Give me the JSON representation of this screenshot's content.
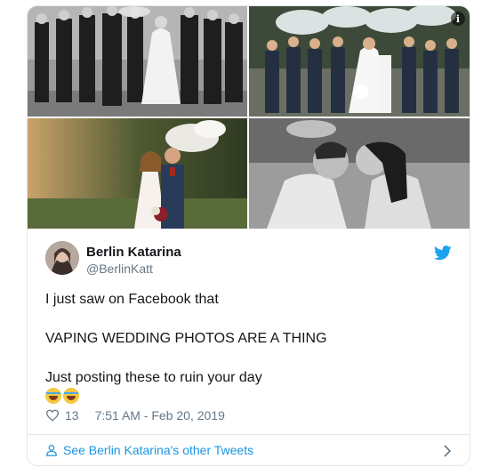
{
  "tweet": {
    "author_name": "Berlin Katarina",
    "author_handle": "@BerlinKatt",
    "text_line1": "I just saw on Facebook that",
    "text_line2": "VAPING WEDDING PHOTOS ARE A THING",
    "text_line3": "Just posting these to ruin your day",
    "emoji": [
      "face-with-tears-of-joy",
      "face-with-tears-of-joy"
    ],
    "likes": "13",
    "timestamp": "7:51 AM - Feb 20, 2019",
    "info_badge": "i"
  },
  "footer": {
    "other_tweets_label": "See Berlin Katarina's other Tweets"
  },
  "icons": {
    "twitter_bird": "twitter-bird-icon",
    "heart": "heart-icon",
    "person": "person-icon",
    "chevron": "chevron-right-icon"
  },
  "colors": {
    "accent": "#1b95e0",
    "bird": "#1da1f2",
    "text": "#14171a",
    "muted": "#657786",
    "border": "#e1e8ed"
  }
}
